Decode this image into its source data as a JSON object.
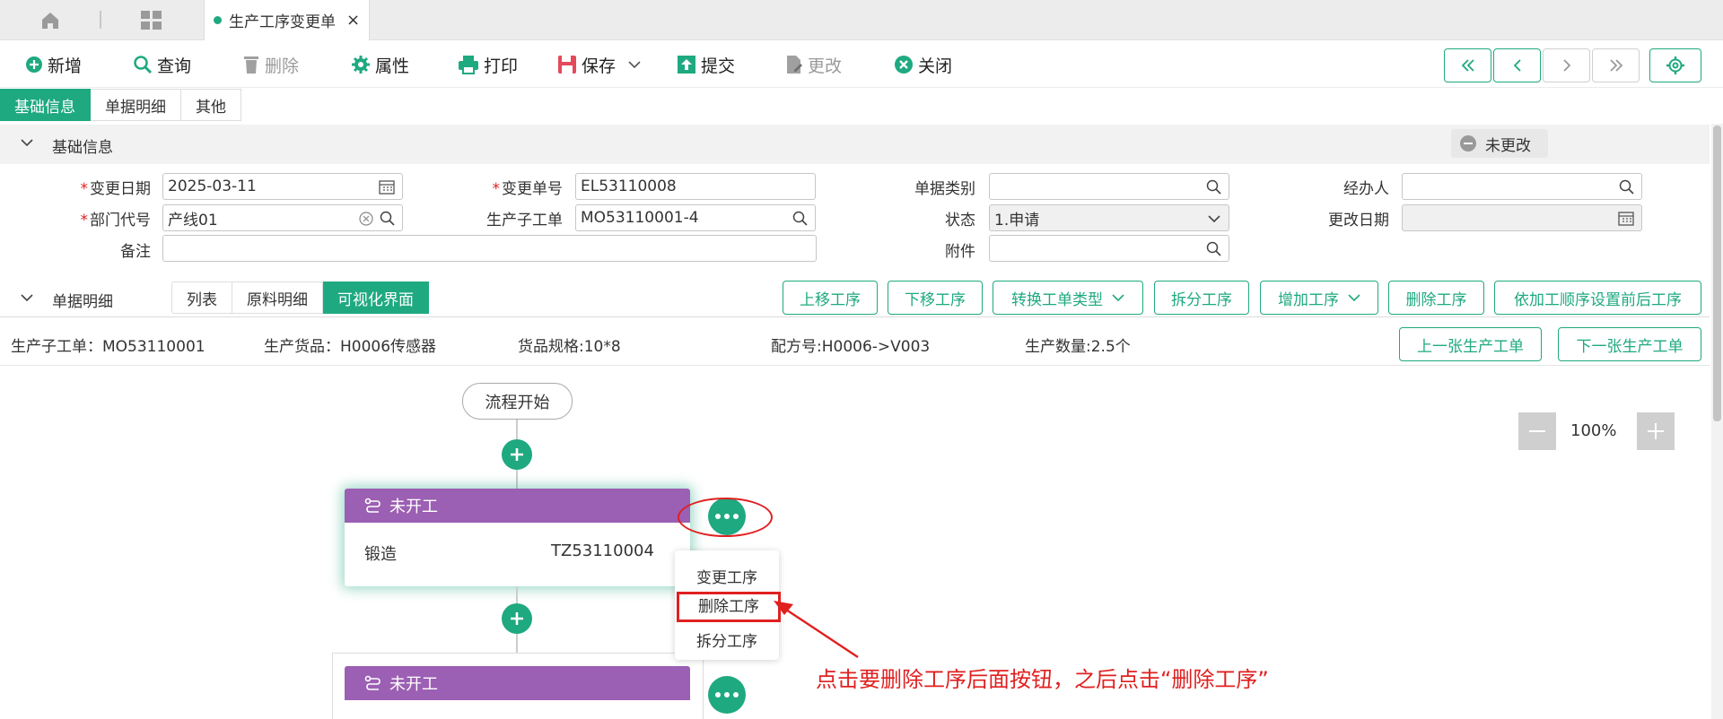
{
  "tabs": {
    "active_title": "生产工序变更单",
    "close_glyph": "×"
  },
  "toolbar": {
    "new": "新增",
    "query": "查询",
    "delete": "删除",
    "props": "属性",
    "print": "打印",
    "save": "保存",
    "submit": "提交",
    "modify": "更改",
    "close": "关闭"
  },
  "subtabs": [
    "基础信息",
    "单据明细",
    "其他"
  ],
  "basic": {
    "title": "基础信息",
    "status_chip": "未更改",
    "fields": {
      "change_date_label": "变更日期",
      "change_date": "2025-03-11",
      "change_no_label": "变更单号",
      "change_no": "EL53110008",
      "doc_type_label": "单据类别",
      "doc_type": "",
      "handler_label": "经办人",
      "handler": "",
      "dept_label": "部门代号",
      "dept": "产线01",
      "sub_order_label": "生产子工单",
      "sub_order": "MO53110001-4",
      "state_label": "状态",
      "state": "1.申请",
      "modify_date_label": "更改日期",
      "modify_date": "",
      "remark_label": "备注",
      "remark": "",
      "attach_label": "附件",
      "attach": ""
    }
  },
  "detail": {
    "title": "单据明细",
    "view_tabs": [
      "列表",
      "原料明细",
      "可视化界面"
    ],
    "buttons": {
      "move_up": "上移工序",
      "move_down": "下移工序",
      "convert": "转换工单类型",
      "split": "拆分工序",
      "add": "增加工序",
      "remove": "删除工序",
      "reorder": "依加工顺序设置前后工序"
    },
    "info": {
      "sub_order": "生产子工单：MO53110001",
      "goods": "生产货品：H0006传感器",
      "spec": "货品规格:10*8",
      "formula": "配方号:H0006->V003",
      "qty": "生产数量:2.5个"
    },
    "prev_order": "上一张生产工单",
    "next_order": "下一张生产工单"
  },
  "canvas": {
    "start": "流程开始",
    "zoom": "100%",
    "card1": {
      "status": "未开工",
      "process": "锻造",
      "code": "TZ53110004"
    },
    "card2": {
      "status": "未开工"
    },
    "menu": [
      "变更工序",
      "删除工序",
      "拆分工序"
    ],
    "annotation": "点击要删除工序后面按钮，之后点击“删除工序”"
  },
  "colors": {
    "accent": "#1fa980",
    "card_header": "#9b5fb3",
    "alert": "#e02020"
  }
}
